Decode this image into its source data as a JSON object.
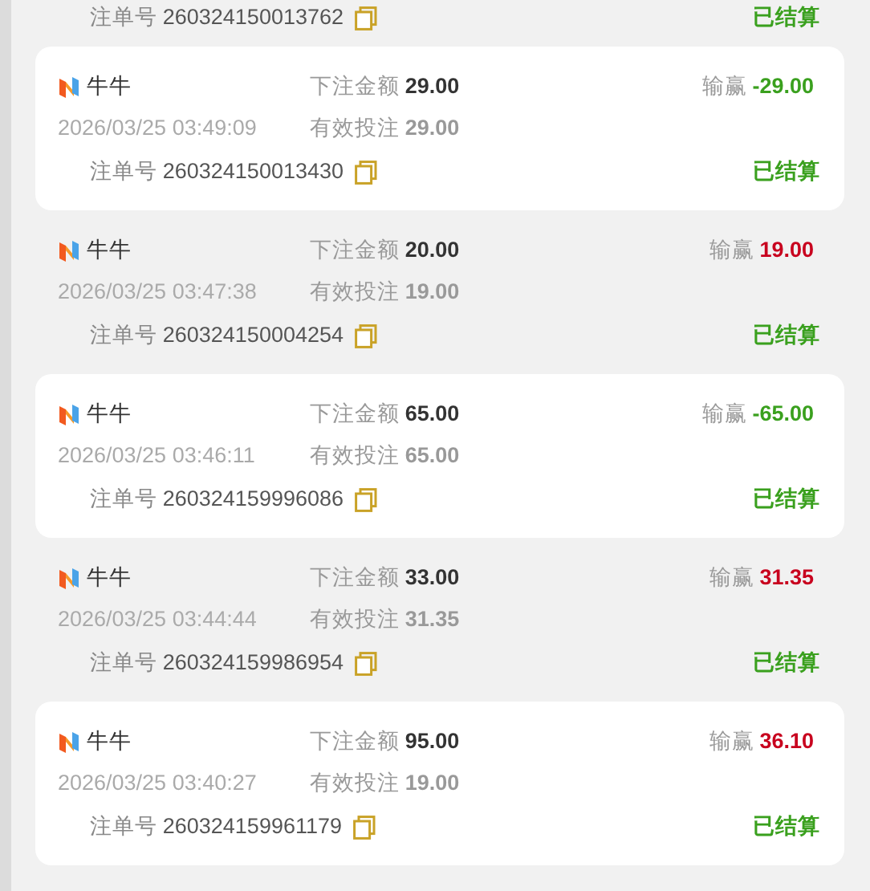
{
  "clipped_entry": {
    "order_label": "注单号",
    "order_no": "260324150013762",
    "status": "已结算"
  },
  "records": [
    {
      "highlighted": true,
      "game": "牛牛",
      "time": "2026/03/25 03:49:09",
      "bet_label": "下注金额",
      "bet": "29.00",
      "valid_label": "有效投注",
      "valid": "29.00",
      "result_label": "输赢",
      "result": "-29.00",
      "kind": "loss",
      "order_label": "注单号",
      "order_no": "260324150013430",
      "status": "已结算"
    },
    {
      "highlighted": false,
      "game": "牛牛",
      "time": "2026/03/25 03:47:38",
      "bet_label": "下注金额",
      "bet": "20.00",
      "valid_label": "有效投注",
      "valid": "19.00",
      "result_label": "输赢",
      "result": "19.00",
      "kind": "win",
      "order_label": "注单号",
      "order_no": "260324150004254",
      "status": "已结算"
    },
    {
      "highlighted": true,
      "game": "牛牛",
      "time": "2026/03/25 03:46:11",
      "bet_label": "下注金额",
      "bet": "65.00",
      "valid_label": "有效投注",
      "valid": "65.00",
      "result_label": "输赢",
      "result": "-65.00",
      "kind": "loss",
      "order_label": "注单号",
      "order_no": "260324159996086",
      "status": "已结算"
    },
    {
      "highlighted": false,
      "game": "牛牛",
      "time": "2026/03/25 03:44:44",
      "bet_label": "下注金额",
      "bet": "33.00",
      "valid_label": "有效投注",
      "valid": "31.35",
      "result_label": "输赢",
      "result": "31.35",
      "kind": "win",
      "order_label": "注单号",
      "order_no": "260324159986954",
      "status": "已结算"
    },
    {
      "highlighted": true,
      "game": "牛牛",
      "time": "2026/03/25 03:40:27",
      "bet_label": "下注金额",
      "bet": "95.00",
      "valid_label": "有效投注",
      "valid": "19.00",
      "result_label": "输赢",
      "result": "36.10",
      "kind": "win",
      "order_label": "注单号",
      "order_no": "260324159961179",
      "status": "已结算"
    }
  ]
}
